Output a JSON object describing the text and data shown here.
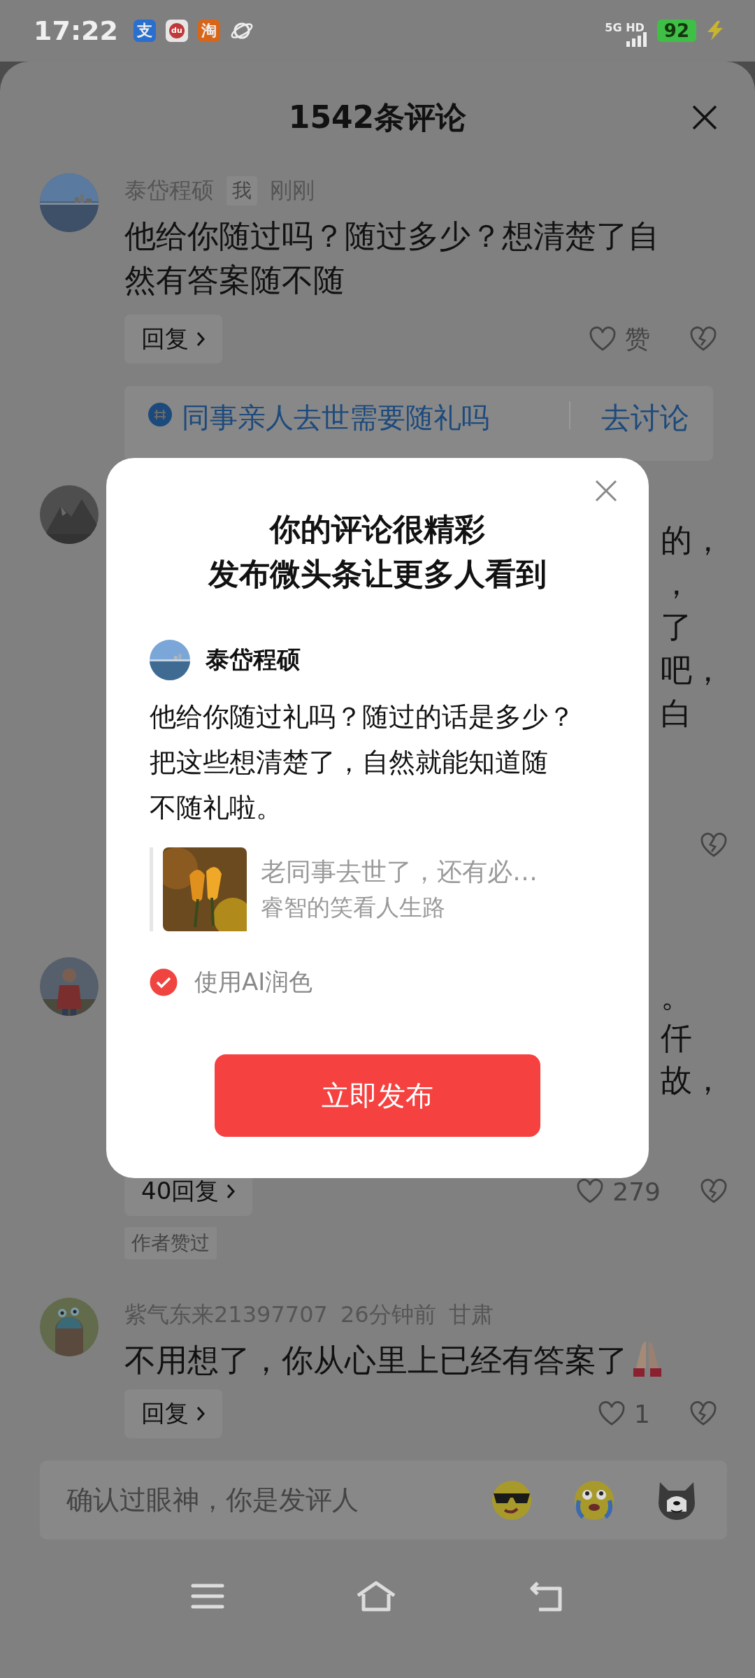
{
  "status_bar": {
    "time": "17:22",
    "app_icons": [
      {
        "kind": "alipay",
        "label": "支"
      },
      {
        "kind": "map",
        "label": "du"
      },
      {
        "kind": "taobao",
        "label": "淘"
      },
      {
        "kind": "browser"
      }
    ],
    "network": "5G HD",
    "battery": "92",
    "charging": true
  },
  "sheet": {
    "title": "1542条评论"
  },
  "comments": [
    {
      "kind": "full",
      "avatar": {
        "kind": "sea"
      },
      "author": "泰岱程硕",
      "badge": "我",
      "time": "刚刚",
      "text": "他给你随过吗？随过多少？想清楚了自然有答案随不随",
      "reply": "回复",
      "likes": "赞",
      "topic": {
        "title": "同事亲人去世需要随礼吗",
        "action": "去讨论"
      }
    },
    {
      "kind": "covered",
      "avatar": {
        "kind": "mountain"
      },
      "fragments": [
        "的，",
        "，",
        "了",
        "吧，",
        "白"
      ]
    },
    {
      "kind": "covered",
      "avatar": {
        "kind": "person"
      },
      "fragments": [
        "。",
        "仟",
        "故，"
      ],
      "reply": "40回复",
      "likes": "279",
      "tag": "作者赞过"
    },
    {
      "kind": "full",
      "avatar": {
        "kind": "cartoon"
      },
      "author": "紫气东来21397707",
      "time": "26分钟前",
      "location": "甘肃",
      "text": "不用想了，你从心里上已经有答案了",
      "emoji": {
        "kind": "praying-hands"
      },
      "reply": "回复",
      "likes": "1"
    }
  ],
  "input": {
    "placeholder": "确认过眼神，你是发评人",
    "stickers": [
      {
        "kind": "sunglasses"
      },
      {
        "kind": "crying"
      },
      {
        "kind": "dog"
      }
    ]
  },
  "modal": {
    "title_lines": [
      "你的评论很精彩",
      "发布微头条让更多人看到"
    ],
    "author": "泰岱程硕",
    "text_lines": [
      "他给你随过礼吗？随过的话是多少？",
      "把这些想清楚了，自然就能知道随",
      "不随礼啦。"
    ],
    "quote": {
      "title": "老同事去世了，还有必…",
      "author": "睿智的笑看人生路"
    },
    "ai_polish": {
      "label": "使用AI润色",
      "checked": true
    },
    "button": "立即发布"
  },
  "nav": [
    {
      "kind": "menu"
    },
    {
      "kind": "home"
    },
    {
      "kind": "back"
    }
  ]
}
